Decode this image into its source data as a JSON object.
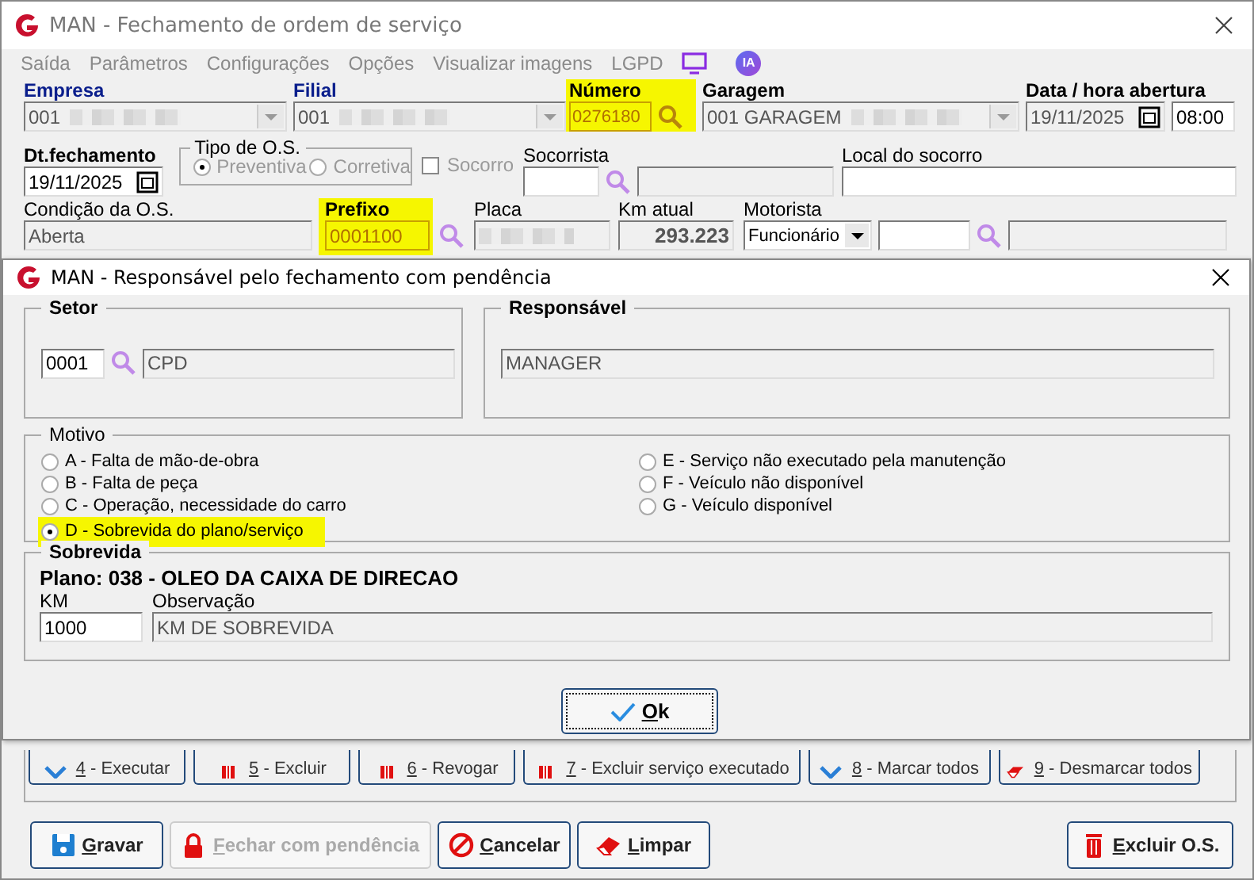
{
  "window": {
    "title": "MAN - Fechamento de ordem de serviço"
  },
  "menu": {
    "items": [
      {
        "label": "Saída",
        "disabled": true
      },
      {
        "label": "Parâmetros",
        "disabled": true
      },
      {
        "label": "Configurações",
        "disabled": true
      },
      {
        "label": "Opções",
        "disabled": true
      },
      {
        "label": "Visualizar imagens",
        "disabled": true
      },
      {
        "label": "LGPD",
        "disabled": true
      }
    ],
    "ia_badge": "IA"
  },
  "row1": [
    {
      "label": "Empresa",
      "color": "#0a1e8c",
      "value": "001",
      "kind": "combo",
      "redacted": true,
      "highlighted": false
    },
    {
      "label": "Filial",
      "color": "#0a1e8c",
      "value": "001",
      "kind": "combo",
      "redacted": true,
      "highlighted": false
    },
    {
      "label": "Número",
      "color": "#000000",
      "value": "0276180",
      "kind": "search",
      "highlighted": true
    },
    {
      "label": "Garagem",
      "color": "#000000",
      "value": "001 GARAGEM",
      "kind": "combo",
      "redacted": true,
      "highlighted": false
    },
    {
      "label": "Data / hora abertura",
      "color": "#000000",
      "value": "19/11/2025",
      "time": "08:00",
      "kind": "date",
      "highlighted": false
    }
  ],
  "row2": {
    "dt_fechamento": {
      "label": "Dt.fechamento",
      "value": "19/11/2025"
    },
    "tipo_os": {
      "legend": "Tipo de O.S.",
      "disabled": true,
      "options": [
        {
          "label": "Preventiva",
          "selected": true
        },
        {
          "label": "Corretiva",
          "selected": false
        }
      ]
    },
    "socorro": {
      "label": "Socorro",
      "checked": false,
      "disabled": true
    },
    "socorrista": {
      "label": "Socorrista"
    },
    "local_socorro": {
      "label": "Local do socorro"
    }
  },
  "row3": {
    "condicao": {
      "label": "Condição da O.S.",
      "value": "Aberta"
    },
    "prefixo": {
      "label": "Prefixo",
      "value": "0001100",
      "highlighted": true
    },
    "placa": {
      "label": "Placa"
    },
    "km_atual": {
      "label": "Km atual",
      "value": "293.223"
    },
    "motorista": {
      "label": "Motorista",
      "type": "Funcionário"
    }
  },
  "action_buttons": [
    {
      "label": "4 - Executar",
      "kind": "check"
    },
    {
      "label": "5 - Excluir",
      "kind": "trash"
    },
    {
      "label": "6 - Revogar",
      "kind": "trash"
    },
    {
      "label": "7 - Excluir serviço executado",
      "kind": "trash"
    },
    {
      "label": "8 - Marcar todos",
      "kind": "check"
    },
    {
      "label": "9 - Desmarcar todos",
      "kind": "eraser"
    }
  ],
  "bottom_buttons": [
    {
      "label": "Gravar",
      "kind": "save",
      "disabled": false
    },
    {
      "label": "Fechar com pendência",
      "kind": "lock",
      "disabled": true
    },
    {
      "label": "Cancelar",
      "kind": "cancel",
      "disabled": false
    },
    {
      "label": "Limpar",
      "kind": "eraser",
      "disabled": false
    },
    {
      "label": "Excluir O.S.",
      "kind": "trash",
      "disabled": false
    }
  ],
  "dialog": {
    "title": "MAN - Responsável pelo fechamento com pendência",
    "setor": {
      "legend": "Setor",
      "code": "0001",
      "name": "CPD"
    },
    "responsavel": {
      "legend": "Responsável",
      "value": "MANAGER"
    },
    "motivo": {
      "legend": "Motivo",
      "options": [
        {
          "label": "A - Falta de mão-de-obra",
          "selected": false,
          "highlighted": false
        },
        {
          "label": "B - Falta de peça",
          "selected": false,
          "highlighted": false
        },
        {
          "label": "C - Operação, necessidade do carro",
          "selected": false,
          "highlighted": false
        },
        {
          "label": "D - Sobrevida do plano/serviço",
          "selected": true,
          "highlighted": true
        },
        {
          "label": "E - Serviço não executado pela manutenção",
          "selected": false,
          "highlighted": false
        },
        {
          "label": "F - Veículo não disponível",
          "selected": false,
          "highlighted": false
        },
        {
          "label": "G - Veículo disponível",
          "selected": false,
          "highlighted": false
        }
      ]
    },
    "sobrevida": {
      "legend": "Sobrevida",
      "plano": "Plano: 038 - OLEO DA CAIXA DE DIRECAO",
      "km_label": "KM",
      "km": "1000",
      "obs_label": "Observação",
      "obs": "KM DE SOBREVIDA"
    },
    "ok_button": "Ok"
  }
}
